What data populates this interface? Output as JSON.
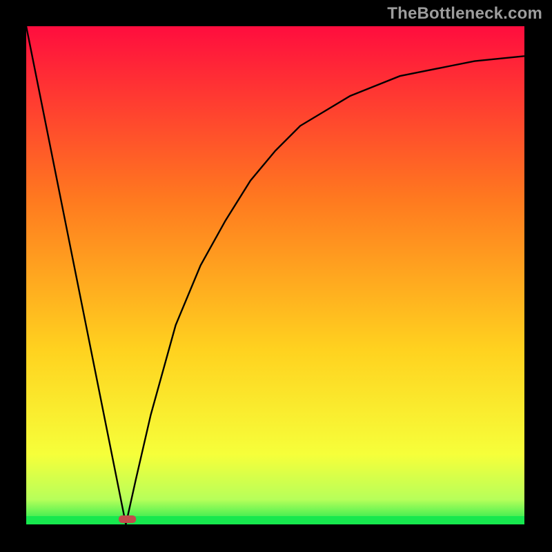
{
  "watermark": "TheBottleneck.com",
  "chart_data": {
    "type": "line",
    "x": [
      0.0,
      0.02,
      0.04,
      0.06,
      0.08,
      0.1,
      0.12,
      0.14,
      0.16,
      0.18,
      0.2,
      0.22,
      0.25,
      0.3,
      0.35,
      0.4,
      0.45,
      0.5,
      0.55,
      0.6,
      0.65,
      0.7,
      0.75,
      0.8,
      0.85,
      0.9,
      0.95,
      1.0
    ],
    "values": [
      1.0,
      0.9,
      0.8,
      0.7,
      0.6,
      0.5,
      0.4,
      0.3,
      0.2,
      0.1,
      0.0,
      0.09,
      0.22,
      0.4,
      0.52,
      0.61,
      0.69,
      0.75,
      0.8,
      0.83,
      0.86,
      0.88,
      0.9,
      0.91,
      0.92,
      0.93,
      0.935,
      0.94
    ],
    "title": "",
    "xlabel": "",
    "ylabel": "",
    "xlim": [
      0,
      1
    ],
    "ylim": [
      0,
      1
    ],
    "notes": "V-shaped curve; steep linear descent to a minimum near x≈0.20, then concave-increasing recovery with diminishing slope. Background is a vertical rainbow gradient (red→orange→yellow→green). Narrow green band at the bottom and a small horizontal red-brown marker at the curve minimum."
  },
  "colors": {
    "grad_top": "#ff0d3e",
    "grad_mid1": "#ff7a1f",
    "grad_mid2": "#ffd21f",
    "grad_low": "#f6ff3a",
    "grad_green_light": "#b7ff5a",
    "grad_green": "#17e84e",
    "curve": "#000000",
    "marker": "#c14b4b",
    "frame": "#000000",
    "watermark": "#9d9d9d"
  },
  "marker": {
    "x_norm": 0.203,
    "width_norm": 0.035
  }
}
